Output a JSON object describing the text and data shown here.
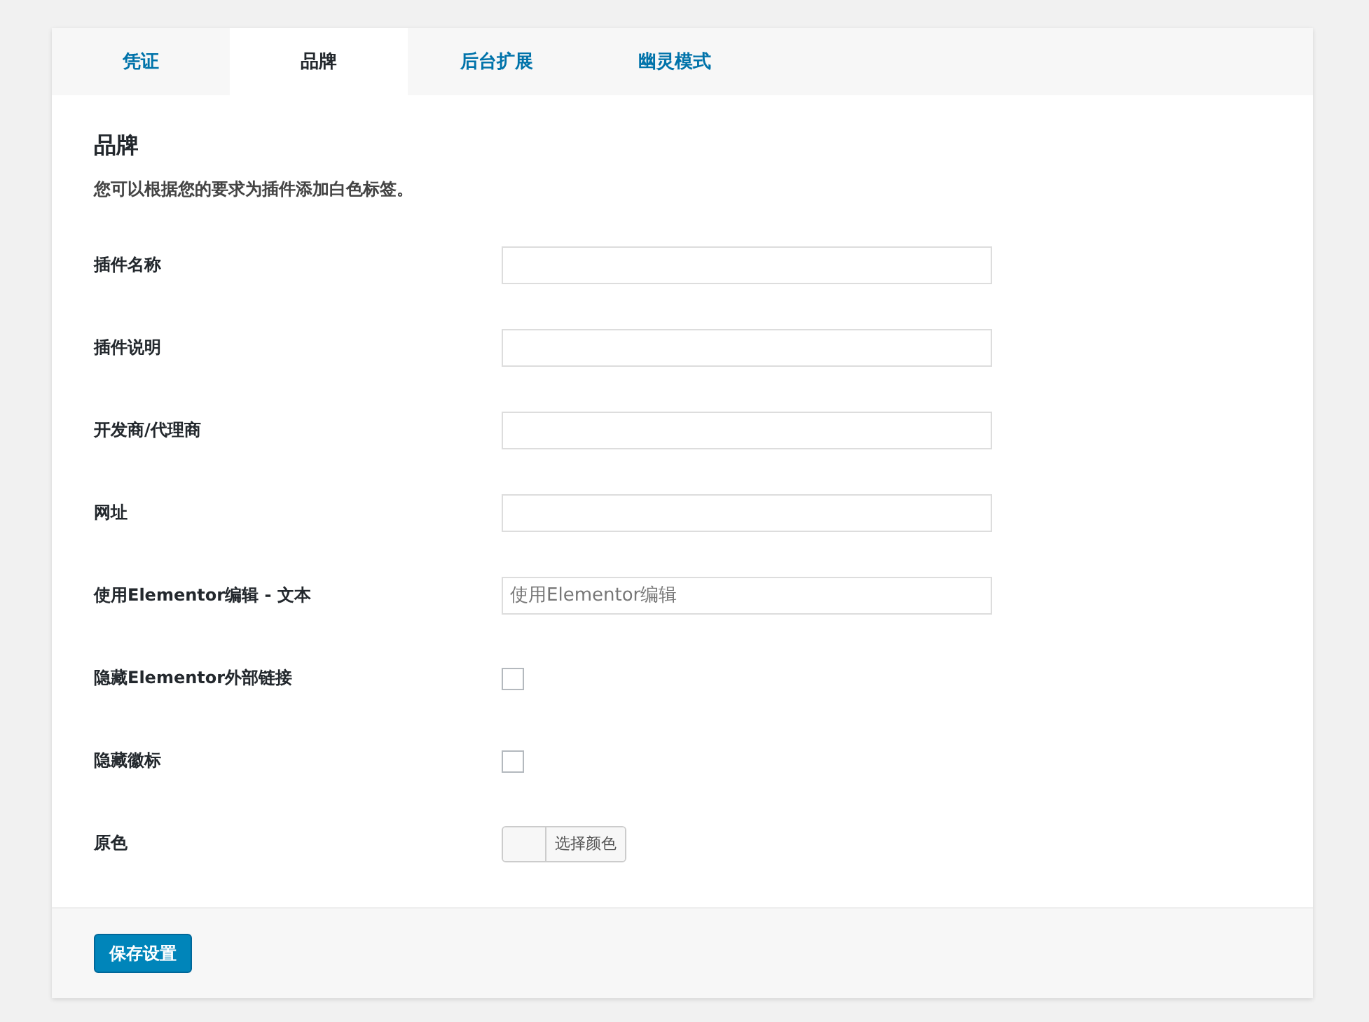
{
  "tabs": [
    {
      "label": "凭证",
      "selected": false
    },
    {
      "label": "品牌",
      "selected": true
    },
    {
      "label": "后台扩展",
      "selected": false
    },
    {
      "label": "幽灵模式",
      "selected": false
    }
  ],
  "section": {
    "title": "品牌",
    "description": "您可以根据您的要求为插件添加白色标签。"
  },
  "fields": [
    {
      "kind": "text",
      "label": "插件名称"
    },
    {
      "kind": "text",
      "label": "插件说明"
    },
    {
      "kind": "text",
      "label": "开发商/代理商"
    },
    {
      "kind": "text",
      "label": "网址"
    },
    {
      "kind": "text",
      "label": "使用Elementor编辑 - 文本",
      "placeholder": "使用Elementor编辑"
    },
    {
      "kind": "checkbox",
      "label": "隐藏Elementor外部链接",
      "checked": false
    },
    {
      "kind": "checkbox",
      "label": "隐藏徽标",
      "checked": false
    },
    {
      "kind": "color",
      "label": "原色",
      "button": "选择颜色"
    }
  ],
  "save_button": "保存设置"
}
